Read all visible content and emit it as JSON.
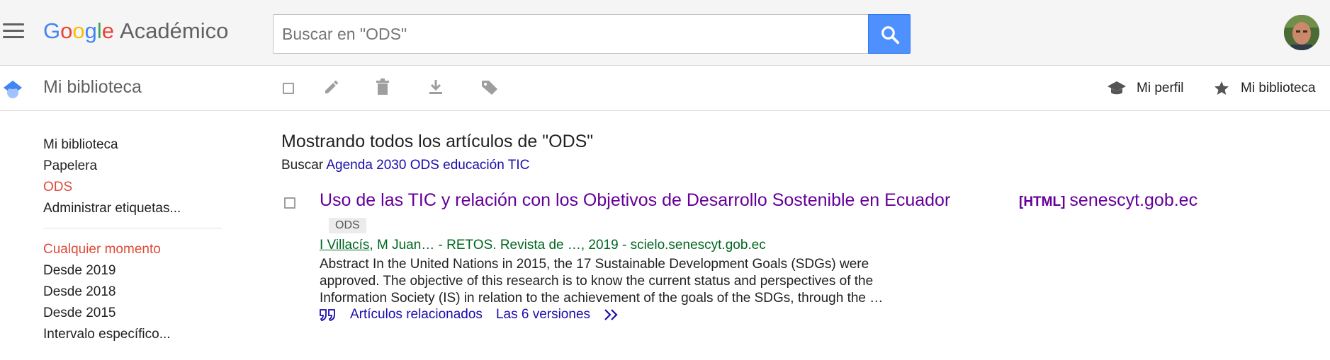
{
  "header": {
    "logo": {
      "letters": [
        "G",
        "o",
        "o",
        "g",
        "l",
        "e"
      ],
      "product": "Académico"
    },
    "search": {
      "value": "",
      "placeholder": "Buscar en \"ODS\""
    },
    "icons": {
      "menu": "hamburger-icon",
      "search": "search-icon",
      "avatar": "avatar"
    }
  },
  "toolbar": {
    "title": "Mi biblioteca",
    "icons": [
      "select-all-checkbox",
      "edit-icon",
      "delete-icon",
      "download-icon",
      "label-icon"
    ],
    "profile_link": "Mi perfil",
    "library_link": "Mi biblioteca"
  },
  "sidebar": {
    "items": [
      {
        "label": "Mi biblioteca",
        "active": false
      },
      {
        "label": "Papelera",
        "active": false
      },
      {
        "label": "ODS",
        "active": true
      },
      {
        "label": "Administrar etiquetas...",
        "active": false
      }
    ],
    "time_filters": [
      {
        "label": "Cualquier momento",
        "active": true
      },
      {
        "label": "Desde 2019",
        "active": false
      },
      {
        "label": "Desde 2018",
        "active": false
      },
      {
        "label": "Desde 2015",
        "active": false
      },
      {
        "label": "Intervalo específico...",
        "active": false
      }
    ]
  },
  "main": {
    "heading": "Mostrando todos los artículos de \"ODS\"",
    "suggest_prefix": "Buscar",
    "suggest_query": "Agenda 2030 ODS educación TIC",
    "results": [
      {
        "title": "Uso de las TIC y relación con los Objetivos de Desarrollo Sostenible en Ecuador",
        "label": "ODS",
        "author_link": "I Villacís",
        "authors_rest": ", M Juan… - RETOS. Revista de …, 2019 - scielo.senescyt.gob.ec",
        "snippet": "Abstract In the United Nations in 2015, the 17 Sustainable Development Goals (SDGs) were approved. The objective of this research is to know the current status and perspectives of the Information Society (IS) in relation to the achievement of the goals of the SDGs, through the …",
        "related": "Artículos relacionados",
        "versions": "Las 6 versiones",
        "side_tag": "[HTML]",
        "side_source": "senescyt.gob.ec"
      }
    ]
  },
  "colors": {
    "accent_blue": "#4d90fe",
    "active_red": "#dd4b39",
    "visited_purple": "#660099",
    "link_blue": "#1a0dab",
    "author_green": "#006621"
  }
}
